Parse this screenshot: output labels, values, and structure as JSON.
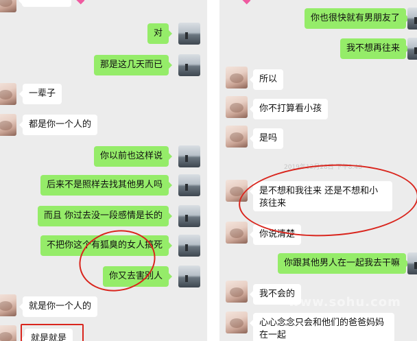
{
  "left_panel": {
    "messages": [
      {
        "dir": "out",
        "text": "对"
      },
      {
        "dir": "out",
        "text": "那是这几天而已"
      },
      {
        "dir": "in",
        "text": "一辈子"
      },
      {
        "dir": "in",
        "text": "都是你一个人的"
      },
      {
        "dir": "out",
        "text": "你以前也这样说"
      },
      {
        "dir": "out",
        "text": "后来不是照样去找其他男人吗"
      },
      {
        "dir": "out",
        "text": "而且 你过去没一段感情是长的"
      },
      {
        "dir": "out",
        "text": "不把你这个有狐臭的女人搞死"
      },
      {
        "dir": "out",
        "text": "你又去害别人"
      },
      {
        "dir": "in",
        "text": "就是你一个人的"
      },
      {
        "dir": "in",
        "text": "就是就是"
      }
    ]
  },
  "right_panel": {
    "timestamp": "2019年12月28日 下午8:48",
    "watermark": "www.sohu.com",
    "messages": [
      {
        "dir": "out",
        "text": "你也很快就有男朋友了"
      },
      {
        "dir": "out",
        "text": "我不想再往来"
      },
      {
        "dir": "in",
        "text": "所以"
      },
      {
        "dir": "in",
        "text": "你不打算看小孩"
      },
      {
        "dir": "in",
        "text": "是吗"
      },
      {
        "dir": "in",
        "text": "是不想和我往来 还是不想和小孩往来"
      },
      {
        "dir": "in",
        "text": "你说清楚"
      },
      {
        "dir": "out",
        "text": "你跟其他男人在一起我去干嘛"
      },
      {
        "dir": "in",
        "text": "我不会的"
      },
      {
        "dir": "in",
        "text": "心心念念只会和他们的爸爸妈妈在一起"
      }
    ]
  },
  "colors": {
    "outgoing_bubble": "#95ec69",
    "incoming_bubble": "#ffffff",
    "background": "#ececec",
    "annotation": "#d9251d"
  }
}
